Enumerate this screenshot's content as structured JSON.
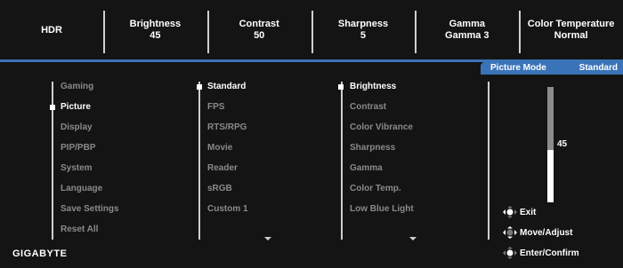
{
  "header": {
    "stats": [
      {
        "title": "HDR",
        "value": ""
      },
      {
        "title": "Brightness",
        "value": "45"
      },
      {
        "title": "Contrast",
        "value": "50"
      },
      {
        "title": "Sharpness",
        "value": "5"
      },
      {
        "title": "Gamma",
        "value": "Gamma 3"
      },
      {
        "title": "Color Temperature",
        "value": "Normal"
      }
    ]
  },
  "tab": {
    "title": "Picture Mode",
    "value": "Standard"
  },
  "menu": [
    "Gaming",
    "Picture",
    "Display",
    "PIP/PBP",
    "System",
    "Language",
    "Save Settings",
    "Reset All"
  ],
  "modes": [
    "Standard",
    "FPS",
    "RTS/RPG",
    "Movie",
    "Reader",
    "sRGB",
    "Custom 1"
  ],
  "settings": [
    "Brightness",
    "Contrast",
    "Color Vibrance",
    "Sharpness",
    "Gamma",
    "Color Temp.",
    "Low Blue Light"
  ],
  "slider": {
    "value": "45",
    "level": 0.45
  },
  "hints": {
    "exit": "Exit",
    "move": "Move/Adjust",
    "confirm": "Enter/Confirm"
  },
  "brand": "GIGABYTE",
  "colors": {
    "accent": "#3b73b8",
    "background": "#141414"
  }
}
